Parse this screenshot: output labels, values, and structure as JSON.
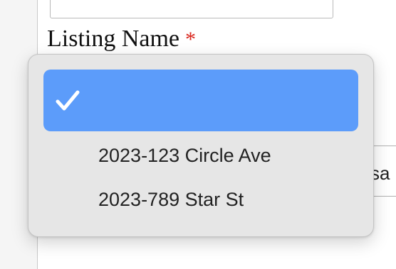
{
  "form": {
    "field_label": "Listing Name",
    "required_marker": "*",
    "background_select_text": "sa"
  },
  "dropdown": {
    "options": [
      {
        "label": "",
        "selected": true,
        "icon": "checkmark-icon"
      },
      {
        "label": "2023-123 Circle Ave",
        "selected": false
      },
      {
        "label": "2023-789 Star St",
        "selected": false
      }
    ]
  },
  "colors": {
    "selection": "#5c9cfa",
    "menu_background": "#e6e6e6",
    "required": "#d9251c"
  }
}
